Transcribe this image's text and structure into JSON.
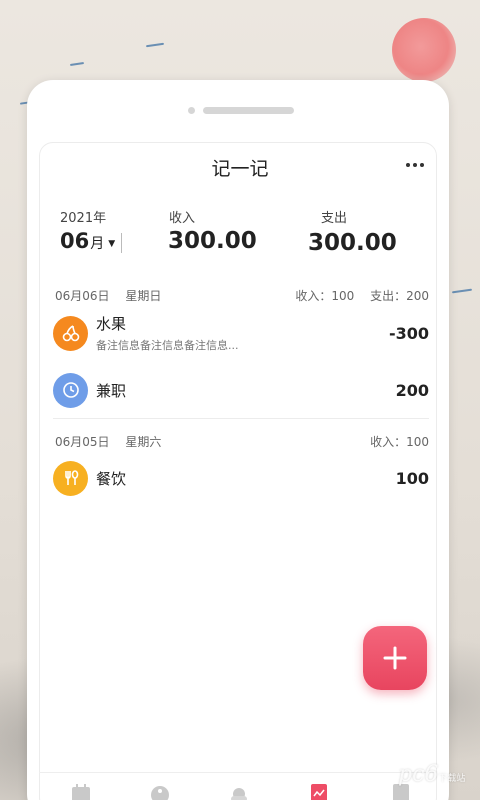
{
  "header": {
    "title": "记一记"
  },
  "summary": {
    "year": "2021年",
    "month": "06",
    "month_unit": "月",
    "income_label": "收入",
    "income_value": "300.00",
    "expense_label": "支出",
    "expense_value": "300.00"
  },
  "groups": [
    {
      "date": "06月06日",
      "weekday": "星期日",
      "income_text": "收入：100",
      "expense_text": "支出：200",
      "entries": [
        {
          "name": "水果",
          "note": "备注信息备注信息备注信息...",
          "amount": "-300",
          "icon": "cherry-icon",
          "color": "#f5891f"
        },
        {
          "name": "兼职",
          "note": "",
          "amount": "200",
          "icon": "clock-icon",
          "color": "#6f9de8"
        }
      ]
    },
    {
      "date": "06月05日",
      "weekday": "星期六",
      "income_text": "收入：100",
      "entries": [
        {
          "name": "餐饮",
          "note": "",
          "amount": "100",
          "icon": "fork-spoon-icon",
          "color": "#f7b021"
        }
      ]
    }
  ],
  "fab": {
    "icon": "plus-icon",
    "color": "#ee4d66"
  },
  "tabs": [
    {
      "icon": "calendar-icon"
    },
    {
      "icon": "yin-yang-icon"
    },
    {
      "icon": "weather-icon"
    },
    {
      "icon": "ledger-icon",
      "active": true
    },
    {
      "icon": "calculator-icon"
    }
  ],
  "watermark": {
    "text": "pc6",
    "subtext": "下载站"
  }
}
